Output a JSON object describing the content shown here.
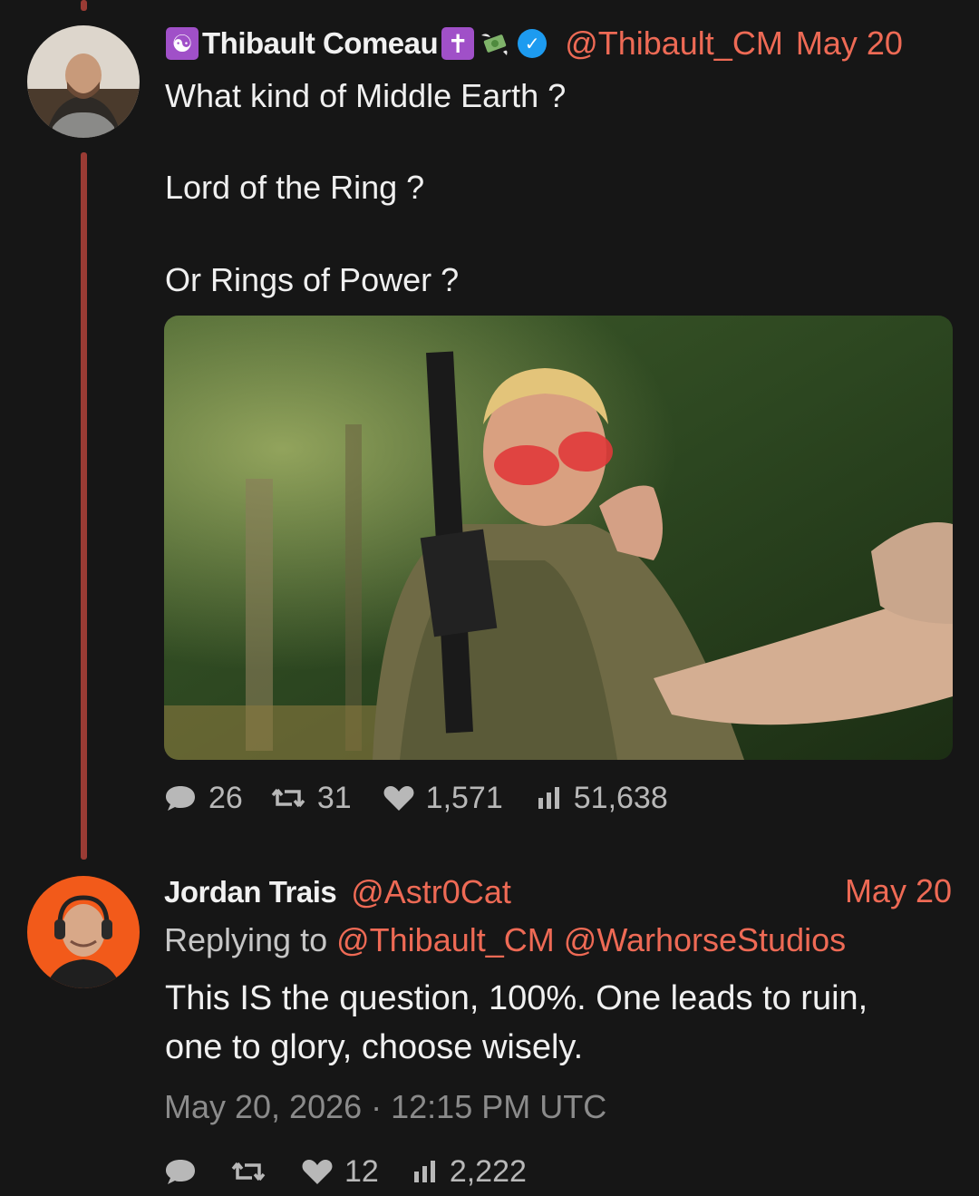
{
  "colors": {
    "background": "#161616",
    "accent": "#ee6a55",
    "thread_line": "#9a3b34",
    "verified": "#1d9bf0"
  },
  "tweet": {
    "name": "Thibault Comeau",
    "name_prefix_icon": "yin-yang-icon",
    "name_suffix_icons": [
      "latin-cross-icon",
      "money-with-wings-icon"
    ],
    "verified": true,
    "handle": "@Thibault_CM",
    "date": "May 20",
    "lines": [
      "What kind of Middle Earth ?",
      "Lord of the Ring ?",
      "Or Rings of Power ?"
    ],
    "stats": {
      "replies": "26",
      "retweets": "31",
      "likes": "1,571",
      "views": "51,638"
    }
  },
  "reply": {
    "name": "Jordan Trais",
    "handle": "@Astr0Cat",
    "date": "May 20",
    "replying_prefix": "Replying to",
    "replying_to": [
      "@Thibault_CM",
      "@WarhorseStudios"
    ],
    "lines": [
      "This IS the question, 100%. One leads to ruin,",
      "one to glory, choose wisely."
    ],
    "timestamp": "May 20, 2026 · 12:15 PM UTC",
    "stats": {
      "replies": "",
      "retweets": "",
      "likes": "12",
      "views": "2,222"
    }
  }
}
